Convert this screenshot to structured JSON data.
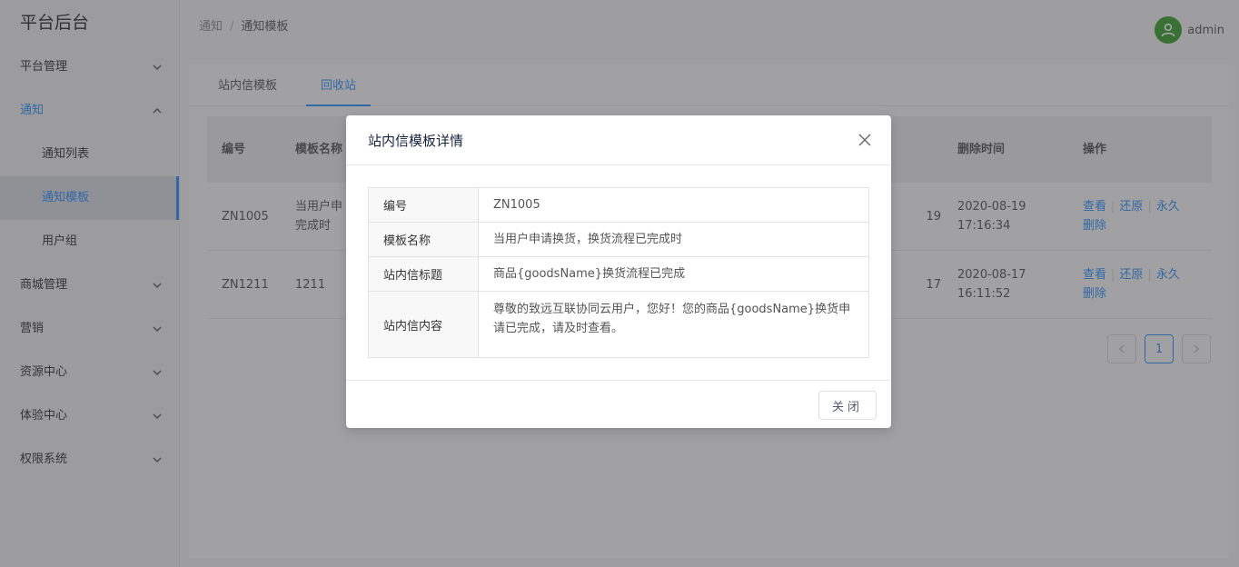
{
  "app": {
    "title": "平台后台"
  },
  "sidebar": {
    "items": [
      {
        "label": "平台管理"
      },
      {
        "label": "通知"
      },
      {
        "label": "商城管理"
      },
      {
        "label": "营销"
      },
      {
        "label": "资源中心"
      },
      {
        "label": "体验中心"
      },
      {
        "label": "权限系统"
      }
    ],
    "notify_sub": [
      {
        "label": "通知列表"
      },
      {
        "label": "通知模板"
      },
      {
        "label": "用户组"
      }
    ]
  },
  "header": {
    "breadcrumb": [
      "通知",
      "通知模板"
    ],
    "separator": "/",
    "user": "admin"
  },
  "tabs": [
    {
      "label": "站内信模板"
    },
    {
      "label": "回收站"
    }
  ],
  "table": {
    "headers": {
      "id": "编号",
      "name": "模板名称",
      "deleted_at": "删除时间",
      "ops": "操作"
    },
    "rows": [
      {
        "id": "ZN1005",
        "name": "当用户申\n完成时",
        "mid": "19",
        "deleted_at": "2020-08-19\n17:16:34"
      },
      {
        "id": "ZN1211",
        "name": "1211",
        "mid": "17",
        "deleted_at": "2020-08-17\n16:11:52"
      }
    ],
    "ops": {
      "view": "查看",
      "restore": "还原",
      "perm_delete": "永久\n删除"
    }
  },
  "pagination": {
    "current": "1"
  },
  "modal": {
    "title": "站内信模板详情",
    "fields": [
      {
        "label": "编号",
        "value": "ZN1005"
      },
      {
        "label": "模板名称",
        "value": "当用户申请换货，换货流程已完成时"
      },
      {
        "label": "站内信标题",
        "value": "商品{goodsName}换货流程已完成"
      },
      {
        "label": "站内信内容",
        "value": "尊敬的致远互联协同云用户，您好！您的商品{goodsName}换货申请已完成，请及时查看。"
      }
    ],
    "close_label": "关闭"
  },
  "colors": {
    "accent": "#2d8cf0",
    "avatar": "#3a9b2e"
  }
}
